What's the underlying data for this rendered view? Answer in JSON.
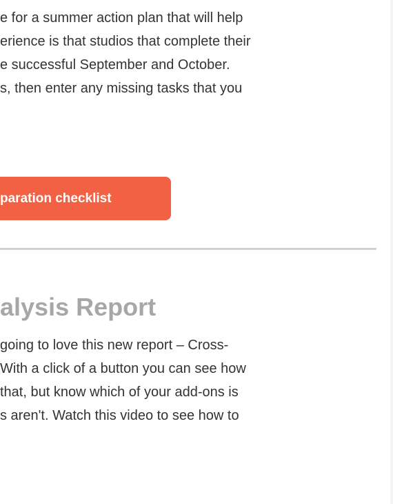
{
  "intro": {
    "lines": [
      "e for a summer action plan that will help",
      "erience is that studios that complete their",
      "e successful September and October.",
      "s, then enter any missing tasks that you"
    ]
  },
  "cta": {
    "label": "paration checklist",
    "color": "#f26143"
  },
  "section": {
    "heading": "alysis Report",
    "lines": [
      "going to love this new report – Cross-",
      " With a click of a button you can see how",
      "that, but know which of your add-ons is",
      "s aren't. Watch this video to see how to"
    ]
  }
}
